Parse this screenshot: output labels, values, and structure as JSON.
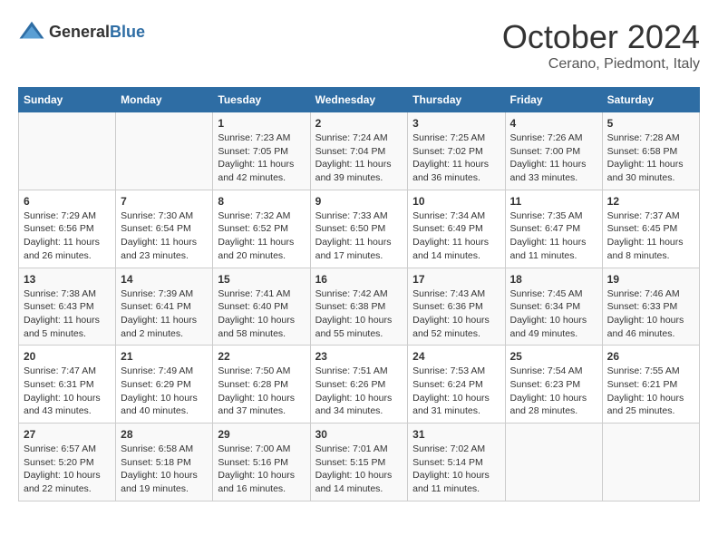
{
  "header": {
    "logo_general": "General",
    "logo_blue": "Blue",
    "month": "October 2024",
    "location": "Cerano, Piedmont, Italy"
  },
  "days_of_week": [
    "Sunday",
    "Monday",
    "Tuesday",
    "Wednesday",
    "Thursday",
    "Friday",
    "Saturday"
  ],
  "weeks": [
    [
      {
        "day": "",
        "info": ""
      },
      {
        "day": "",
        "info": ""
      },
      {
        "day": "1",
        "sunrise": "Sunrise: 7:23 AM",
        "sunset": "Sunset: 7:05 PM",
        "daylight": "Daylight: 11 hours and 42 minutes."
      },
      {
        "day": "2",
        "sunrise": "Sunrise: 7:24 AM",
        "sunset": "Sunset: 7:04 PM",
        "daylight": "Daylight: 11 hours and 39 minutes."
      },
      {
        "day": "3",
        "sunrise": "Sunrise: 7:25 AM",
        "sunset": "Sunset: 7:02 PM",
        "daylight": "Daylight: 11 hours and 36 minutes."
      },
      {
        "day": "4",
        "sunrise": "Sunrise: 7:26 AM",
        "sunset": "Sunset: 7:00 PM",
        "daylight": "Daylight: 11 hours and 33 minutes."
      },
      {
        "day": "5",
        "sunrise": "Sunrise: 7:28 AM",
        "sunset": "Sunset: 6:58 PM",
        "daylight": "Daylight: 11 hours and 30 minutes."
      }
    ],
    [
      {
        "day": "6",
        "sunrise": "Sunrise: 7:29 AM",
        "sunset": "Sunset: 6:56 PM",
        "daylight": "Daylight: 11 hours and 26 minutes."
      },
      {
        "day": "7",
        "sunrise": "Sunrise: 7:30 AM",
        "sunset": "Sunset: 6:54 PM",
        "daylight": "Daylight: 11 hours and 23 minutes."
      },
      {
        "day": "8",
        "sunrise": "Sunrise: 7:32 AM",
        "sunset": "Sunset: 6:52 PM",
        "daylight": "Daylight: 11 hours and 20 minutes."
      },
      {
        "day": "9",
        "sunrise": "Sunrise: 7:33 AM",
        "sunset": "Sunset: 6:50 PM",
        "daylight": "Daylight: 11 hours and 17 minutes."
      },
      {
        "day": "10",
        "sunrise": "Sunrise: 7:34 AM",
        "sunset": "Sunset: 6:49 PM",
        "daylight": "Daylight: 11 hours and 14 minutes."
      },
      {
        "day": "11",
        "sunrise": "Sunrise: 7:35 AM",
        "sunset": "Sunset: 6:47 PM",
        "daylight": "Daylight: 11 hours and 11 minutes."
      },
      {
        "day": "12",
        "sunrise": "Sunrise: 7:37 AM",
        "sunset": "Sunset: 6:45 PM",
        "daylight": "Daylight: 11 hours and 8 minutes."
      }
    ],
    [
      {
        "day": "13",
        "sunrise": "Sunrise: 7:38 AM",
        "sunset": "Sunset: 6:43 PM",
        "daylight": "Daylight: 11 hours and 5 minutes."
      },
      {
        "day": "14",
        "sunrise": "Sunrise: 7:39 AM",
        "sunset": "Sunset: 6:41 PM",
        "daylight": "Daylight: 11 hours and 2 minutes."
      },
      {
        "day": "15",
        "sunrise": "Sunrise: 7:41 AM",
        "sunset": "Sunset: 6:40 PM",
        "daylight": "Daylight: 10 hours and 58 minutes."
      },
      {
        "day": "16",
        "sunrise": "Sunrise: 7:42 AM",
        "sunset": "Sunset: 6:38 PM",
        "daylight": "Daylight: 10 hours and 55 minutes."
      },
      {
        "day": "17",
        "sunrise": "Sunrise: 7:43 AM",
        "sunset": "Sunset: 6:36 PM",
        "daylight": "Daylight: 10 hours and 52 minutes."
      },
      {
        "day": "18",
        "sunrise": "Sunrise: 7:45 AM",
        "sunset": "Sunset: 6:34 PM",
        "daylight": "Daylight: 10 hours and 49 minutes."
      },
      {
        "day": "19",
        "sunrise": "Sunrise: 7:46 AM",
        "sunset": "Sunset: 6:33 PM",
        "daylight": "Daylight: 10 hours and 46 minutes."
      }
    ],
    [
      {
        "day": "20",
        "sunrise": "Sunrise: 7:47 AM",
        "sunset": "Sunset: 6:31 PM",
        "daylight": "Daylight: 10 hours and 43 minutes."
      },
      {
        "day": "21",
        "sunrise": "Sunrise: 7:49 AM",
        "sunset": "Sunset: 6:29 PM",
        "daylight": "Daylight: 10 hours and 40 minutes."
      },
      {
        "day": "22",
        "sunrise": "Sunrise: 7:50 AM",
        "sunset": "Sunset: 6:28 PM",
        "daylight": "Daylight: 10 hours and 37 minutes."
      },
      {
        "day": "23",
        "sunrise": "Sunrise: 7:51 AM",
        "sunset": "Sunset: 6:26 PM",
        "daylight": "Daylight: 10 hours and 34 minutes."
      },
      {
        "day": "24",
        "sunrise": "Sunrise: 7:53 AM",
        "sunset": "Sunset: 6:24 PM",
        "daylight": "Daylight: 10 hours and 31 minutes."
      },
      {
        "day": "25",
        "sunrise": "Sunrise: 7:54 AM",
        "sunset": "Sunset: 6:23 PM",
        "daylight": "Daylight: 10 hours and 28 minutes."
      },
      {
        "day": "26",
        "sunrise": "Sunrise: 7:55 AM",
        "sunset": "Sunset: 6:21 PM",
        "daylight": "Daylight: 10 hours and 25 minutes."
      }
    ],
    [
      {
        "day": "27",
        "sunrise": "Sunrise: 6:57 AM",
        "sunset": "Sunset: 5:20 PM",
        "daylight": "Daylight: 10 hours and 22 minutes."
      },
      {
        "day": "28",
        "sunrise": "Sunrise: 6:58 AM",
        "sunset": "Sunset: 5:18 PM",
        "daylight": "Daylight: 10 hours and 19 minutes."
      },
      {
        "day": "29",
        "sunrise": "Sunrise: 7:00 AM",
        "sunset": "Sunset: 5:16 PM",
        "daylight": "Daylight: 10 hours and 16 minutes."
      },
      {
        "day": "30",
        "sunrise": "Sunrise: 7:01 AM",
        "sunset": "Sunset: 5:15 PM",
        "daylight": "Daylight: 10 hours and 14 minutes."
      },
      {
        "day": "31",
        "sunrise": "Sunrise: 7:02 AM",
        "sunset": "Sunset: 5:14 PM",
        "daylight": "Daylight: 10 hours and 11 minutes."
      },
      {
        "day": "",
        "info": ""
      },
      {
        "day": "",
        "info": ""
      }
    ]
  ]
}
